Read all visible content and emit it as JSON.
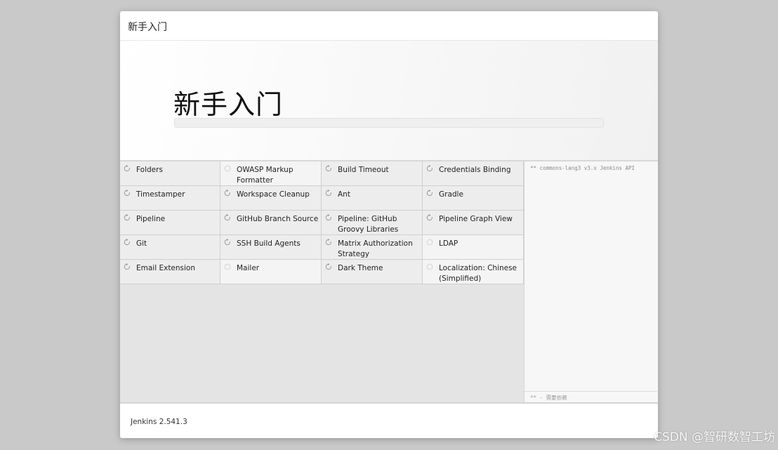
{
  "header": {
    "title": "新手入门"
  },
  "hero": {
    "title": "新手入门",
    "progress": 0
  },
  "plugins": [
    {
      "name": "Folders",
      "status": "installing"
    },
    {
      "name": "OWASP Markup Formatter",
      "status": "pending"
    },
    {
      "name": "Build Timeout",
      "status": "installing"
    },
    {
      "name": "Credentials Binding",
      "status": "installing"
    },
    {
      "name": "Timestamper",
      "status": "installing"
    },
    {
      "name": "Workspace Cleanup",
      "status": "installing"
    },
    {
      "name": "Ant",
      "status": "installing"
    },
    {
      "name": "Gradle",
      "status": "installing"
    },
    {
      "name": "Pipeline",
      "status": "installing"
    },
    {
      "name": "GitHub Branch Source",
      "status": "installing"
    },
    {
      "name": "Pipeline: GitHub Groovy Libraries",
      "status": "installing"
    },
    {
      "name": "Pipeline Graph View",
      "status": "installing"
    },
    {
      "name": "Git",
      "status": "installing"
    },
    {
      "name": "SSH Build Agents",
      "status": "installing"
    },
    {
      "name": "Matrix Authorization Strategy",
      "status": "installing"
    },
    {
      "name": "LDAP",
      "status": "pending"
    },
    {
      "name": "Email Extension",
      "status": "installing"
    },
    {
      "name": "Mailer",
      "status": "pending"
    },
    {
      "name": "Dark Theme",
      "status": "installing"
    },
    {
      "name": "Localization: Chinese (Simplified)",
      "status": "pending"
    }
  ],
  "log": {
    "line": "** commons-lang3 v3.x Jenkins API",
    "footer": "** - 需要依赖"
  },
  "footer": {
    "version": "Jenkins 2.541.3"
  },
  "watermark": "CSDN @智研数智工坊",
  "colors": {
    "background": "#c9c9c9",
    "progress": "#4b8f3a",
    "icon": "#9a9a9a"
  }
}
